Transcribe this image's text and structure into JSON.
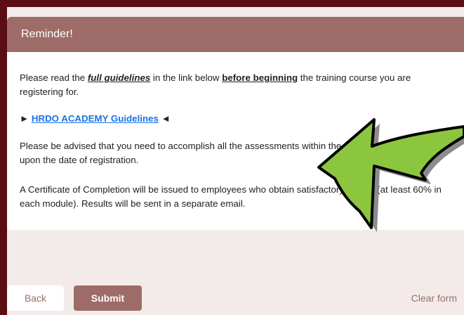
{
  "card": {
    "title": "Reminder!",
    "p1": {
      "t1": "Please read the ",
      "emph": "full guidelines",
      "t2": " in the link below ",
      "bold": "before beginning",
      "t3": " the training course you are registering for."
    },
    "link": {
      "prefix": "► ",
      "label": "HRDO ACADEMY Guidelines",
      "suffix": " ◄"
    },
    "p3": "Please be advised that you need to accomplish all the assessments within the prescribed timeframe upon the date of registration.",
    "p4": "A Certificate of Completion will be issued to employees who obtain satisfactory ratings (at least 60% in each module). Results will be sent in a separate email."
  },
  "footer": {
    "back_label": "Back",
    "submit_label": "Submit",
    "clear_label": "Clear form"
  },
  "colors": {
    "accent": "#9e6c68",
    "border": "#5a0d12",
    "arrow": "#8cc63f"
  },
  "overlay": {
    "icon": "curved-arrow-icon"
  }
}
